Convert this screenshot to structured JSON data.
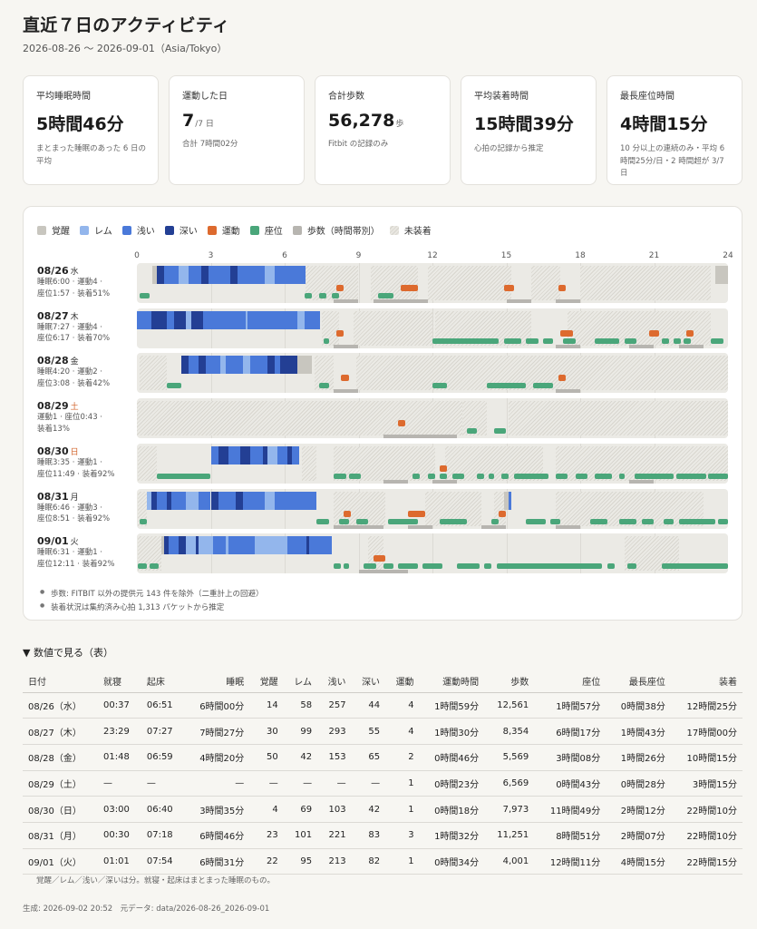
{
  "header": {
    "title": "直近７日のアクティビティ",
    "period": "2026-08-26 〜 2026-09-01（Asia/Tokyo）"
  },
  "cards": [
    {
      "label": "平均睡眠時間",
      "value": "5時間46分",
      "unit": "",
      "note": "まとまった睡眠のあった 6 日の平均"
    },
    {
      "label": "運動した日",
      "value": "7",
      "unit": "/7 日",
      "note": "合計 7時間02分"
    },
    {
      "label": "合計歩数",
      "value": "56,278",
      "unit": "歩",
      "note": "Fitbit の記録のみ"
    },
    {
      "label": "平均装着時間",
      "value": "15時間39分",
      "unit": "",
      "note": "心拍の記録から推定"
    },
    {
      "label": "最長座位時間",
      "value": "4時間15分",
      "unit": "",
      "note": "10 分以上の連続のみ・平均 6時間25分/日・2 時間超が 3/7 日"
    }
  ],
  "colors": {
    "awake": "#c8c6bf",
    "rem": "#93b6ec",
    "light": "#4a79d9",
    "deep": "#233f94",
    "exercise": "#dd6a2e",
    "sedentary": "#4aa67a",
    "steps": "#b7b5b0",
    "unworn": "#dedcd5"
  },
  "legend": [
    {
      "key": "awake",
      "label": "覚醒"
    },
    {
      "key": "rem",
      "label": "レム"
    },
    {
      "key": "light",
      "label": "浅い"
    },
    {
      "key": "deep",
      "label": "深い"
    },
    {
      "key": "exercise",
      "label": "運動"
    },
    {
      "key": "sedentary",
      "label": "座位"
    },
    {
      "key": "steps",
      "label": "歩数（時間帯別）"
    },
    {
      "key": "unworn",
      "label": "未装着"
    }
  ],
  "axis_ticks": [
    "0",
    "3",
    "6",
    "9",
    "12",
    "15",
    "18",
    "21",
    "24"
  ],
  "timeline_rows": [
    {
      "date": "08/26",
      "dow": "水",
      "weekend": false,
      "stats": [
        "睡眠6:00 · 運動4 ·",
        "座位1:57 · 装着51%"
      ],
      "sleep": [
        [
          0.62,
          "awake"
        ],
        [
          0.82,
          "deep"
        ],
        [
          1.1,
          "light"
        ],
        [
          1.7,
          "rem"
        ],
        [
          2.1,
          "light"
        ],
        [
          2.6,
          "deep"
        ],
        [
          2.9,
          "light"
        ],
        [
          3.8,
          "deep"
        ],
        [
          4.1,
          "light"
        ],
        [
          5.2,
          "rem"
        ],
        [
          5.6,
          "light"
        ],
        [
          6.85,
          "end"
        ]
      ],
      "unworn": [
        [
          6.85,
          9.0
        ],
        [
          9.5,
          11.4
        ],
        [
          11.8,
          15.2
        ],
        [
          16.0,
          17.2
        ],
        [
          18.0,
          23.3
        ]
      ],
      "awake_extra": [
        [
          23.5,
          24.0
        ]
      ],
      "exercise": [
        [
          8.1,
          8.4
        ],
        [
          10.7,
          11.4
        ],
        [
          14.9,
          15.3
        ],
        [
          17.1,
          17.4
        ]
      ],
      "sedentary": [
        [
          0.1,
          0.5
        ],
        [
          6.8,
          7.1
        ],
        [
          7.4,
          7.7
        ],
        [
          7.9,
          8.2
        ],
        [
          9.8,
          10.4
        ]
      ],
      "steps": [
        [
          8.0,
          9.0
        ],
        [
          9.6,
          10.4
        ],
        [
          10.3,
          11.8
        ],
        [
          15.0,
          16.0
        ],
        [
          17.0,
          18.0
        ]
      ]
    },
    {
      "date": "08/27",
      "dow": "木",
      "weekend": false,
      "stats": [
        "睡眠7:27 · 運動4 ·",
        "座位6:17 · 装着70%"
      ],
      "sleep": [
        [
          0.0,
          "light"
        ],
        [
          0.6,
          "deep"
        ],
        [
          1.2,
          "light"
        ],
        [
          1.5,
          "deep"
        ],
        [
          2.0,
          "rem"
        ],
        [
          2.2,
          "deep"
        ],
        [
          2.7,
          "light"
        ],
        [
          4.4,
          "rem"
        ],
        [
          4.5,
          "light"
        ],
        [
          6.5,
          "rem"
        ],
        [
          6.8,
          "light"
        ],
        [
          7.45,
          "end"
        ]
      ],
      "unworn": [
        [
          7.5,
          8.2
        ],
        [
          8.8,
          12.0
        ],
        [
          12.1,
          16.0
        ],
        [
          17.5,
          23.3
        ]
      ],
      "awake_extra": [],
      "exercise": [
        [
          8.1,
          8.4
        ],
        [
          17.2,
          17.7
        ],
        [
          20.8,
          21.2
        ],
        [
          22.3,
          22.6
        ]
      ],
      "sedentary": [
        [
          7.6,
          7.8
        ],
        [
          12.0,
          14.7
        ],
        [
          14.9,
          15.6
        ],
        [
          15.8,
          16.3
        ],
        [
          16.5,
          16.9
        ],
        [
          17.3,
          17.8
        ],
        [
          18.6,
          19.6
        ],
        [
          19.8,
          20.3
        ],
        [
          21.3,
          21.6
        ],
        [
          21.8,
          22.1
        ],
        [
          22.2,
          22.5
        ],
        [
          23.3,
          23.8
        ]
      ],
      "steps": [
        [
          8.0,
          9.0
        ],
        [
          17.0,
          18.0
        ],
        [
          20.0,
          21.0
        ],
        [
          22.0,
          23.0
        ]
      ]
    },
    {
      "date": "08/28",
      "dow": "金",
      "weekend": false,
      "stats": [
        "睡眠4:20 · 運動2 ·",
        "座位3:08 · 装着42%"
      ],
      "sleep": [
        [
          1.8,
          "deep"
        ],
        [
          2.1,
          "light"
        ],
        [
          2.5,
          "deep"
        ],
        [
          2.8,
          "light"
        ],
        [
          3.4,
          "rem"
        ],
        [
          3.6,
          "light"
        ],
        [
          4.3,
          "rem"
        ],
        [
          4.6,
          "light"
        ],
        [
          5.3,
          "deep"
        ],
        [
          5.6,
          "light"
        ],
        [
          5.8,
          "deep"
        ],
        [
          6.5,
          "awake"
        ],
        [
          7.1,
          "end"
        ]
      ],
      "unworn": [
        [
          0.1,
          1.2
        ],
        [
          7.2,
          8.0
        ],
        [
          8.9,
          24.0
        ]
      ],
      "awake_extra": [],
      "exercise": [
        [
          8.3,
          8.6
        ],
        [
          17.1,
          17.4
        ]
      ],
      "sedentary": [
        [
          1.2,
          1.8
        ],
        [
          7.4,
          7.8
        ],
        [
          12.0,
          12.6
        ],
        [
          14.2,
          15.8
        ],
        [
          16.1,
          16.9
        ]
      ],
      "steps": [
        [
          8.0,
          9.0
        ],
        [
          17.0,
          18.0
        ]
      ]
    },
    {
      "date": "08/29",
      "dow": "土",
      "weekend": true,
      "stats": [
        "運動1 · 座位0:43 ·",
        "装着13%"
      ],
      "sleep": [],
      "unworn": [
        [
          0.0,
          13.2
        ],
        [
          13.2,
          14.2
        ],
        [
          15.1,
          24.0
        ]
      ],
      "awake_extra": [],
      "exercise": [
        [
          10.6,
          10.9
        ]
      ],
      "sedentary": [
        [
          13.4,
          13.8
        ],
        [
          14.5,
          15.0
        ]
      ],
      "steps": [
        [
          10.0,
          12.0
        ],
        [
          12.0,
          13.0
        ]
      ]
    },
    {
      "date": "08/30",
      "dow": "日",
      "weekend": true,
      "stats": [
        "睡眠3:35 · 運動1 ·",
        "座位11:49 · 装着92%"
      ],
      "sleep": [
        [
          3.0,
          "light"
        ],
        [
          3.3,
          "deep"
        ],
        [
          3.7,
          "light"
        ],
        [
          4.2,
          "deep"
        ],
        [
          4.6,
          "light"
        ],
        [
          5.1,
          "deep"
        ],
        [
          5.3,
          "rem"
        ],
        [
          5.7,
          "light"
        ],
        [
          6.1,
          "deep"
        ],
        [
          6.3,
          "light"
        ],
        [
          6.6,
          "end"
        ]
      ],
      "unworn": [
        [
          0.05,
          0.8
        ],
        [
          6.7,
          7.3
        ],
        [
          8.0,
          12.1
        ],
        [
          12.5,
          16.5
        ],
        [
          17.0,
          24.0
        ]
      ],
      "awake_extra": [],
      "exercise": [
        [
          12.3,
          12.6
        ]
      ],
      "sedentary": [
        [
          0.8,
          3.0
        ],
        [
          8.0,
          8.5
        ],
        [
          8.6,
          9.1
        ],
        [
          11.2,
          11.5
        ],
        [
          11.8,
          12.1
        ],
        [
          12.3,
          12.6
        ],
        [
          12.8,
          13.3
        ],
        [
          13.8,
          14.1
        ],
        [
          14.3,
          14.5
        ],
        [
          14.8,
          15.1
        ],
        [
          15.3,
          16.7
        ],
        [
          17.0,
          17.5
        ],
        [
          17.8,
          18.3
        ],
        [
          18.6,
          19.3
        ],
        [
          19.6,
          19.8
        ],
        [
          20.2,
          21.8
        ],
        [
          21.9,
          23.1
        ],
        [
          23.2,
          24.0
        ]
      ],
      "steps": [
        [
          10.0,
          11.0
        ],
        [
          12.0,
          13.0
        ],
        [
          20.0,
          21.0
        ]
      ]
    },
    {
      "date": "08/31",
      "dow": "月",
      "weekend": false,
      "stats": [
        "睡眠6:46 · 運動3 ·",
        "座位8:51 · 装着92%"
      ],
      "sleep": [
        [
          0.4,
          "rem"
        ],
        [
          0.6,
          "deep"
        ],
        [
          0.8,
          "light"
        ],
        [
          1.2,
          "deep"
        ],
        [
          1.4,
          "light"
        ],
        [
          2.0,
          "rem"
        ],
        [
          2.5,
          "light"
        ],
        [
          3.0,
          "deep"
        ],
        [
          3.3,
          "light"
        ],
        [
          4.0,
          "deep"
        ],
        [
          4.3,
          "light"
        ],
        [
          5.2,
          "rem"
        ],
        [
          5.6,
          "light"
        ],
        [
          7.3,
          "end"
        ]
      ],
      "unworn": [
        [
          0.05,
          0.4
        ],
        [
          8.0,
          10.1
        ],
        [
          11.7,
          14.0
        ],
        [
          14.5,
          15.0
        ],
        [
          17.0,
          23.0
        ]
      ],
      "awake_extra": [
        [
          14.9,
          15.1
        ]
      ],
      "extra_sleep": [
        [
          15.1,
          15.2,
          "light"
        ]
      ],
      "exercise": [
        [
          8.4,
          8.7
        ],
        [
          11.0,
          11.7
        ],
        [
          14.7,
          15.0
        ]
      ],
      "sedentary": [
        [
          0.1,
          0.4
        ],
        [
          7.3,
          7.8
        ],
        [
          8.2,
          8.6
        ],
        [
          8.9,
          9.4
        ],
        [
          10.2,
          11.4
        ],
        [
          12.3,
          13.4
        ],
        [
          14.4,
          14.7
        ],
        [
          15.8,
          16.6
        ],
        [
          16.8,
          17.2
        ],
        [
          18.4,
          19.1
        ],
        [
          19.6,
          20.3
        ],
        [
          20.5,
          21.0
        ],
        [
          21.4,
          21.8
        ],
        [
          22.0,
          23.5
        ],
        [
          23.6,
          24.0
        ]
      ],
      "steps": [
        [
          8.0,
          10.0
        ],
        [
          11.0,
          12.0
        ],
        [
          14.0,
          15.0
        ],
        [
          17.0,
          18.0
        ]
      ]
    },
    {
      "date": "09/01",
      "dow": "火",
      "weekend": false,
      "stats": [
        "睡眠6:31 · 運動1 ·",
        "座位12:11 · 装着92%"
      ],
      "sleep": [
        [
          1.0,
          "awake"
        ],
        [
          1.1,
          "deep"
        ],
        [
          1.3,
          "light"
        ],
        [
          1.7,
          "deep"
        ],
        [
          2.0,
          "rem"
        ],
        [
          2.4,
          "deep"
        ],
        [
          2.5,
          "rem"
        ],
        [
          3.1,
          "light"
        ],
        [
          3.6,
          "rem"
        ],
        [
          3.7,
          "light"
        ],
        [
          4.8,
          "rem"
        ],
        [
          6.1,
          "light"
        ],
        [
          6.9,
          "deep"
        ],
        [
          7.0,
          "light"
        ],
        [
          7.9,
          "end"
        ]
      ],
      "unworn": [
        [
          0.05,
          1.0
        ],
        [
          9.4,
          10.0
        ],
        [
          19.8,
          22.0
        ]
      ],
      "awake_extra": [],
      "exercise": [
        [
          9.6,
          10.1
        ]
      ],
      "sedentary": [
        [
          0.05,
          0.4
        ],
        [
          0.5,
          0.9
        ],
        [
          8.0,
          8.3
        ],
        [
          8.4,
          8.6
        ],
        [
          9.2,
          9.7
        ],
        [
          10.0,
          10.4
        ],
        [
          10.6,
          11.4
        ],
        [
          11.6,
          12.4
        ],
        [
          13.0,
          13.9
        ],
        [
          14.1,
          14.4
        ],
        [
          14.6,
          18.9
        ],
        [
          19.1,
          19.4
        ],
        [
          19.9,
          20.3
        ],
        [
          21.3,
          24.0
        ]
      ],
      "steps": [
        [
          9.0,
          10.0
        ],
        [
          10.0,
          11.0
        ]
      ]
    }
  ],
  "notes": [
    "歩数: FITBIT 以外の提供元 143 件を除外（二重計上の回避）",
    "装着状況は集約済み心拍 1,313 パケットから推定"
  ],
  "details_title": "▼ 数値で見る（表）",
  "table": {
    "headers": [
      "日付",
      "就寝",
      "起床",
      "睡眠",
      "覚醒",
      "レム",
      "浅い",
      "深い",
      "運動",
      "運動時間",
      "歩数",
      "座位",
      "最長座位",
      "装着"
    ],
    "align": [
      "l",
      "l",
      "l",
      "r",
      "r",
      "r",
      "r",
      "r",
      "r",
      "r",
      "r",
      "r",
      "r",
      "r"
    ],
    "rows": [
      [
        "08/26（水）",
        "00:37",
        "06:51",
        "6時間00分",
        "14",
        "58",
        "257",
        "44",
        "4",
        "1時間59分",
        "12,561",
        "1時間57分",
        "0時間38分",
        "12時間25分"
      ],
      [
        "08/27（木）",
        "23:29",
        "07:27",
        "7時間27分",
        "30",
        "99",
        "293",
        "55",
        "4",
        "1時間30分",
        "8,354",
        "6時間17分",
        "1時間43分",
        "17時間00分"
      ],
      [
        "08/28（金）",
        "01:48",
        "06:59",
        "4時間20分",
        "50",
        "42",
        "153",
        "65",
        "2",
        "0時間46分",
        "5,569",
        "3時間08分",
        "1時間26分",
        "10時間15分"
      ],
      [
        "08/29（土）",
        "—",
        "—",
        "—",
        "—",
        "—",
        "—",
        "—",
        "1",
        "0時間23分",
        "6,569",
        "0時間43分",
        "0時間28分",
        "3時間15分"
      ],
      [
        "08/30（日）",
        "03:00",
        "06:40",
        "3時間35分",
        "4",
        "69",
        "103",
        "42",
        "1",
        "0時間18分",
        "7,973",
        "11時間49分",
        "2時間12分",
        "22時間10分"
      ],
      [
        "08/31（月）",
        "00:30",
        "07:18",
        "6時間46分",
        "23",
        "101",
        "221",
        "83",
        "3",
        "1時間32分",
        "11,251",
        "8時間51分",
        "2時間07分",
        "22時間10分"
      ],
      [
        "09/01（火）",
        "01:01",
        "07:54",
        "6時間31分",
        "22",
        "95",
        "213",
        "82",
        "1",
        "0時間34分",
        "4,001",
        "12時間11分",
        "4時間15分",
        "22時間15分"
      ]
    ]
  },
  "table_note": "覚醒／レム／浅い／深いは分。就寝・起床はまとまった睡眠のもの。",
  "footer": "生成: 2026-09-02 20:52　元データ: data/2026-08-26_2026-09-01"
}
